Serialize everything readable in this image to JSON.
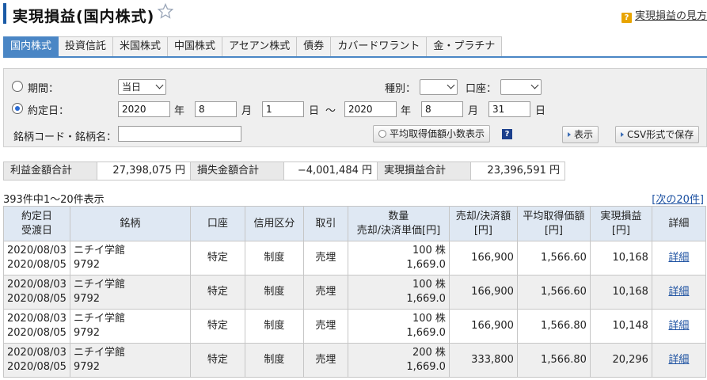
{
  "page": {
    "title": "実現損益(国内株式)",
    "help_label": "実現損益の見方"
  },
  "tabs": [
    "国内株式",
    "投資信託",
    "米国株式",
    "中国株式",
    "アセアン株式",
    "債券",
    "カバードワラント",
    "金・プラチナ"
  ],
  "filter": {
    "period_label": "期間：",
    "period_value": "当日",
    "contract_date_label": "約定日：",
    "from_year": "2020",
    "from_month": "8",
    "from_day": "1",
    "to_year": "2020",
    "to_month": "8",
    "to_day": "31",
    "year_unit": "年",
    "month_unit": "月",
    "day_unit": "日",
    "range_sep": "～",
    "type_label": "種別：",
    "type_value": "",
    "account_label": "口座：",
    "account_value": "",
    "code_label": "銘柄コード・銘柄名：",
    "code_value": "",
    "avg_decimal_button": "平均取得価額小数表示",
    "show_button": "表示",
    "csv_button": "CSV形式で保存"
  },
  "summary": {
    "profit_label": "利益金額合計",
    "profit_value": "27,398,075 円",
    "loss_label": "損失金額合計",
    "loss_value": "−4,001,484 円",
    "realized_label": "実現損益合計",
    "realized_value": "23,396,591 円"
  },
  "results": {
    "count_text": "393件中1～20件表示",
    "next_link": "次の20件"
  },
  "table": {
    "headers": {
      "date1": "約定日",
      "date2": "受渡日",
      "stock": "銘柄",
      "account": "口座",
      "credit": "信用区分",
      "trade": "取引",
      "qty1": "数量",
      "qty2": "売却/決済単価[円]",
      "amount1": "売却/決済額",
      "amount2": "[円]",
      "avg1": "平均取得価額",
      "avg2": "[円]",
      "pl1": "実現損益",
      "pl2": "[円]",
      "detail": "詳細"
    },
    "rows": [
      {
        "contract_date": "2020/08/03",
        "settle_date": "2020/08/05",
        "name": "ニチイ学館",
        "code": "9792",
        "account": "特定",
        "credit": "制度",
        "trade": "売埋",
        "qty": "100 株",
        "price": "1,669.0",
        "amount": "166,900",
        "avg_cost": "1,566.60",
        "pl": "10,168",
        "detail": "詳細"
      },
      {
        "contract_date": "2020/08/03",
        "settle_date": "2020/08/05",
        "name": "ニチイ学館",
        "code": "9792",
        "account": "特定",
        "credit": "制度",
        "trade": "売埋",
        "qty": "100 株",
        "price": "1,669.0",
        "amount": "166,900",
        "avg_cost": "1,566.60",
        "pl": "10,168",
        "detail": "詳細"
      },
      {
        "contract_date": "2020/08/03",
        "settle_date": "2020/08/05",
        "name": "ニチイ学館",
        "code": "9792",
        "account": "特定",
        "credit": "制度",
        "trade": "売埋",
        "qty": "100 株",
        "price": "1,669.0",
        "amount": "166,900",
        "avg_cost": "1,566.80",
        "pl": "10,148",
        "detail": "詳細"
      },
      {
        "contract_date": "2020/08/03",
        "settle_date": "2020/08/05",
        "name": "ニチイ学館",
        "code": "9792",
        "account": "特定",
        "credit": "制度",
        "trade": "売埋",
        "qty": "200 株",
        "price": "1,669.0",
        "amount": "333,800",
        "avg_cost": "1,566.80",
        "pl": "20,296",
        "detail": "詳細"
      }
    ]
  },
  "colors": {
    "tab_active": "#4a86c5",
    "header_bg": "#dfe8f3",
    "link": "#1a4fa0"
  }
}
